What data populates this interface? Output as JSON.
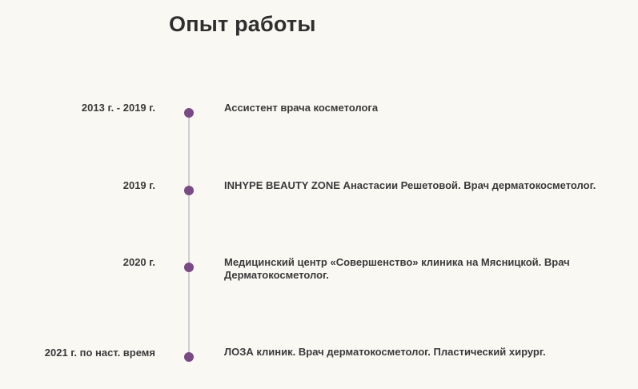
{
  "title": "Опыт работы",
  "timeline": [
    {
      "date": "2013 г. - 2019 г.",
      "description": "Ассистент врача косметолога"
    },
    {
      "date": "2019 г.",
      "description": "INHYPE BEAUTY ZONE Анастасии Решетовой. Врач дерматокосметолог."
    },
    {
      "date": "2020 г.",
      "description": "Медицинский центр «Совершенство» клиника на Мясницкой. Врач Дерматокосметолог."
    },
    {
      "date": "2021 г. по наст. время",
      "description": "ЛОЗА клиник. Врач дерматокосметолог. Пластический хирург."
    }
  ],
  "colors": {
    "background": "#faf8f3",
    "dot": "#7a4a86",
    "line": "#cfcfcf",
    "text": "#3a3a3a"
  }
}
